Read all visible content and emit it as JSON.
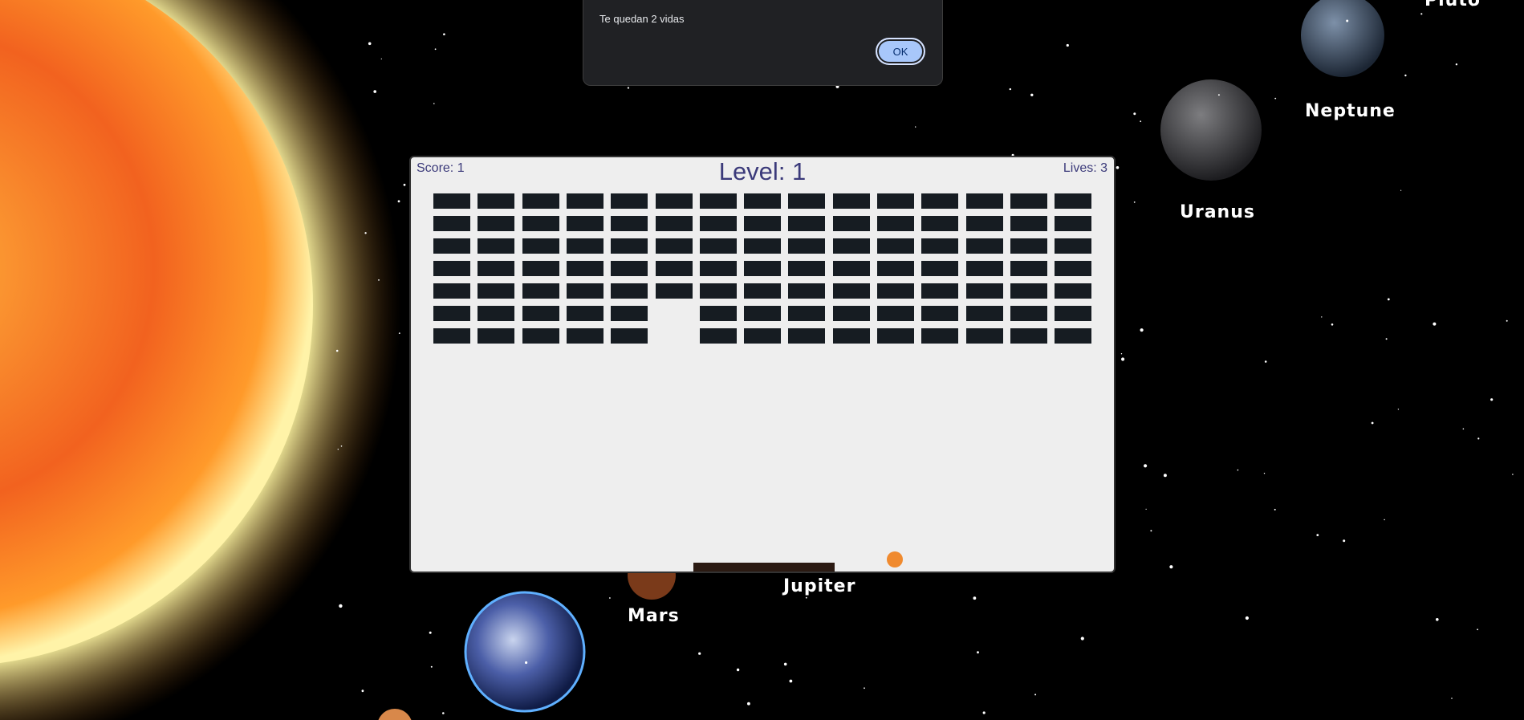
{
  "hud": {
    "score": "Score: 1",
    "level": "Level: 1",
    "lives": "Lives: 3"
  },
  "dialog": {
    "title": "",
    "message": "Te quedan 2 vidas",
    "ok_label": "OK"
  },
  "planets": [
    {
      "name": "Mars"
    },
    {
      "name": "Jupiter"
    },
    {
      "name": "Uranus"
    },
    {
      "name": "Neptune"
    },
    {
      "name": "Pluto"
    }
  ],
  "bricks": {
    "rows": 7,
    "cols": 15,
    "missing": [
      [
        5,
        5
      ],
      [
        6,
        5
      ]
    ]
  },
  "colors": {
    "brick": "#161c22",
    "ball": "#f08a2e",
    "paddle": "#2b1a12",
    "panel": "#eeeeee",
    "text": "#3b3a7a"
  }
}
